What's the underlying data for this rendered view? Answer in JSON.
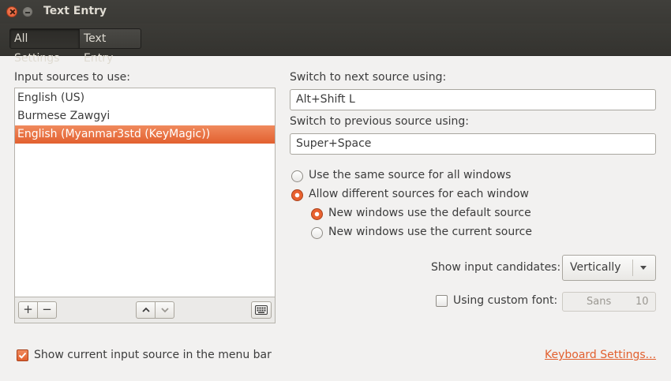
{
  "window": {
    "title": "Text Entry"
  },
  "breadcrumb": {
    "all_settings": "All Settings",
    "current": "Text Entry"
  },
  "sources": {
    "label": "Input sources to use:",
    "items": [
      "English (US)",
      "Burmese Zawgyi",
      "English (Myanmar3std (KeyMagic))"
    ],
    "selected_index": 2
  },
  "list_toolbar": {
    "add": "+",
    "remove": "−"
  },
  "next_source": {
    "label": "Switch to next source using:",
    "value": "Alt+Shift L"
  },
  "prev_source": {
    "label": "Switch to previous source using:",
    "value": "Super+Space"
  },
  "options": {
    "same_source": "Use the same source for all windows",
    "different_sources": "Allow different sources for each window",
    "new_default": "New windows use the default source",
    "new_current": "New windows use the current source",
    "selected": "different_sources",
    "sub_selected": "new_default"
  },
  "candidates": {
    "label": "Show input candidates:",
    "value": "Vertically"
  },
  "custom_font": {
    "label": "Using custom font:",
    "checked": false,
    "font_name": "Sans",
    "font_size": "10"
  },
  "menu_bar": {
    "label": "Show current input source in the menu bar",
    "checked": true
  },
  "keyboard_settings_link": "Keyboard Settings...",
  "colors": {
    "accent": "#e2602f",
    "titlebar": "#3c3b37",
    "background": "#f2f1f0"
  }
}
